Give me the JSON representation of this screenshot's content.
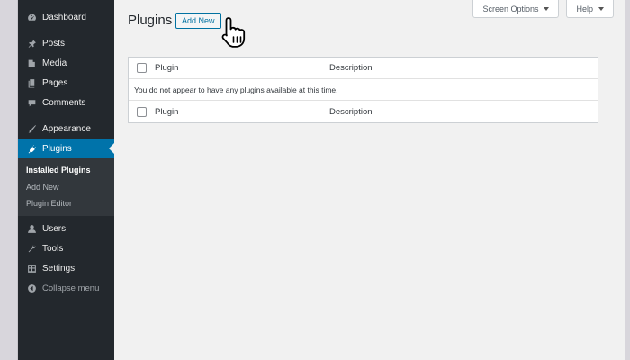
{
  "sidebar": {
    "items": [
      {
        "label": "Dashboard",
        "icon": "dashboard-icon"
      },
      {
        "label": "Posts",
        "icon": "pin-icon"
      },
      {
        "label": "Media",
        "icon": "media-icon"
      },
      {
        "label": "Pages",
        "icon": "pages-icon"
      },
      {
        "label": "Comments",
        "icon": "comment-icon"
      },
      {
        "label": "Appearance",
        "icon": "brush-icon"
      },
      {
        "label": "Plugins",
        "icon": "plug-icon"
      },
      {
        "label": "Users",
        "icon": "user-icon"
      },
      {
        "label": "Tools",
        "icon": "wrench-icon"
      },
      {
        "label": "Settings",
        "icon": "settings-icon"
      }
    ],
    "submenu": [
      {
        "label": "Installed Plugins"
      },
      {
        "label": "Add New"
      },
      {
        "label": "Plugin Editor"
      }
    ],
    "collapse_label": "Collapse menu"
  },
  "header": {
    "title": "Plugins",
    "add_new_label": "Add New",
    "screen_options_label": "Screen Options",
    "help_label": "Help"
  },
  "table": {
    "columns": [
      "Plugin",
      "Description"
    ],
    "empty_message": "You do not appear to have any plugins available at this time."
  },
  "colors": {
    "sidebar_bg": "#23282d",
    "accent": "#0073aa",
    "page_bg": "#f1f1f1"
  }
}
